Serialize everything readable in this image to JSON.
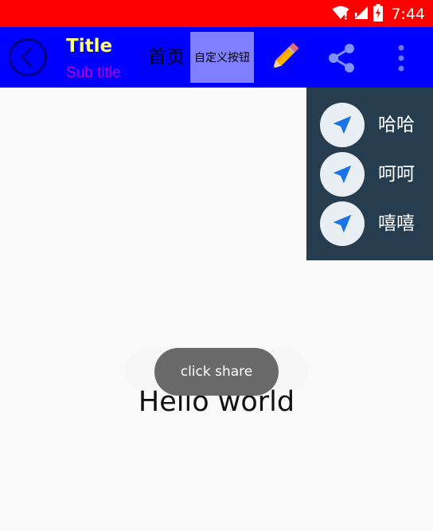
{
  "status_bar": {
    "time": "7:44",
    "color": "#ff0000",
    "icons": [
      "wifi-icon",
      "signal-icon",
      "battery-icon"
    ]
  },
  "toolbar": {
    "background": "#0000ff",
    "title": "Title",
    "subtitle": "Sub title",
    "home_label": "首页",
    "custom_button_label": "自定义按钮",
    "actions": [
      "edit-icon",
      "share-icon",
      "more-icon"
    ]
  },
  "popup_menu": {
    "background": "#263d4f",
    "items": [
      {
        "label": "哈哈",
        "icon": "navigation-icon"
      },
      {
        "label": "呵呵",
        "icon": "navigation-icon"
      },
      {
        "label": "嘻嘻",
        "icon": "navigation-icon"
      }
    ]
  },
  "main": {
    "text": "Hello world"
  },
  "toast": {
    "text": "click share"
  }
}
